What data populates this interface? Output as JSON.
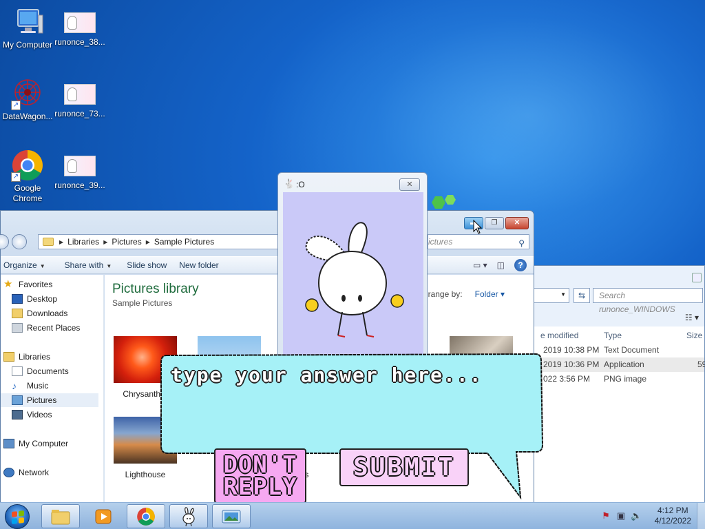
{
  "desktop": {
    "icons": [
      {
        "label": "My Computer"
      },
      {
        "label": "runonce_38..."
      },
      {
        "label": "DataWagon..."
      },
      {
        "label": "runonce_73..."
      },
      {
        "label": "Google Chrome"
      },
      {
        "label": "runonce_39..."
      }
    ]
  },
  "explorer_back": {
    "search_placeholder": "Search runonce_WINDOWS",
    "columns": [
      "e modified",
      "Type",
      "Size"
    ],
    "rows": [
      {
        "modified": "2019 10:38 PM",
        "type": "Text Document",
        "size": ""
      },
      {
        "modified": "2019 10:36 PM",
        "type": "Application",
        "size": "59"
      },
      {
        "modified": "022 3:56 PM",
        "type": "PNG image",
        "size": ""
      }
    ]
  },
  "explorer": {
    "breadcrumb": [
      "Libraries",
      "Pictures",
      "Sample Pictures"
    ],
    "search_placeholder": "ictures",
    "toolbar": {
      "organize": "Organize",
      "share_with": "Share with",
      "slide_show": "Slide show",
      "new_folder": "New folder"
    },
    "nav": {
      "favorites": "Favorites",
      "desktop": "Desktop",
      "downloads": "Downloads",
      "recent_places": "Recent Places",
      "libraries": "Libraries",
      "documents": "Documents",
      "music": "Music",
      "pictures": "Pictures",
      "videos": "Videos",
      "my_computer": "My Computer",
      "network": "Network"
    },
    "library_title": "Pictures library",
    "library_sub": "Sample Pictures",
    "arrange_label": "range by:",
    "arrange_value": "Folder",
    "pictures": [
      {
        "label": "Chrysanther"
      },
      {
        "label": "Lighthouse"
      },
      {
        "label": "ulips"
      }
    ]
  },
  "app": {
    "title": ":O"
  },
  "prompt": {
    "answer_placeholder": "type your answer here...",
    "dont_reply": "DON'T REPLY",
    "submit": "SUBMIT"
  },
  "taskbar": {
    "time": "4:12 PM",
    "date": "4/12/2022"
  }
}
